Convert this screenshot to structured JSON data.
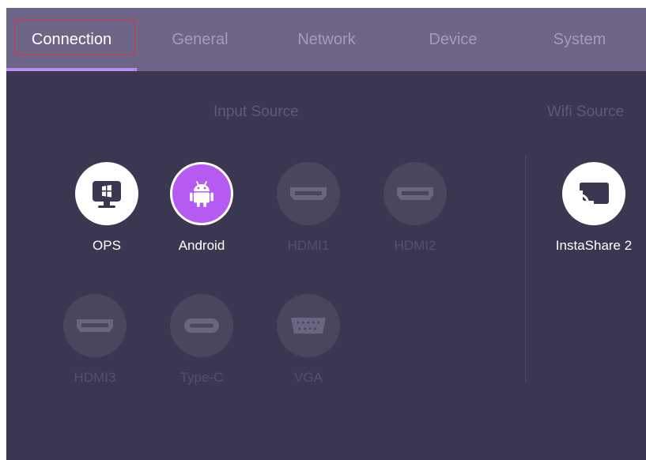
{
  "tabs": [
    {
      "label": "Connection",
      "active": true
    },
    {
      "label": "General",
      "active": false
    },
    {
      "label": "Network",
      "active": false
    },
    {
      "label": "Device",
      "active": false
    },
    {
      "label": "System",
      "active": false
    }
  ],
  "sections": {
    "input_title": "Input Source",
    "wifi_title": "Wifi Source"
  },
  "inputs": [
    {
      "label": "OPS",
      "icon": "ops-monitor-icon",
      "state": "available"
    },
    {
      "label": "Android",
      "icon": "android-icon",
      "state": "selected"
    },
    {
      "label": "HDMI1",
      "icon": "hdmi-port-icon",
      "state": "unavailable"
    },
    {
      "label": "HDMI2",
      "icon": "hdmi-port-icon",
      "state": "unavailable"
    },
    {
      "label": "HDMI3",
      "icon": "hdmi-port-icon",
      "state": "unavailable"
    },
    {
      "label": "Type-C",
      "icon": "usb-c-port-icon",
      "state": "unavailable"
    },
    {
      "label": "VGA",
      "icon": "vga-port-icon",
      "state": "unavailable"
    }
  ],
  "wifi_sources": [
    {
      "label": "InstaShare 2",
      "icon": "cast-icon",
      "state": "available"
    }
  ],
  "colors": {
    "background": "#3b3750",
    "tab_bar": "#6e6587",
    "accent_underline": "#b88cf5",
    "selected_source": "#b55bf2",
    "focus_outline": "#e0303a"
  }
}
